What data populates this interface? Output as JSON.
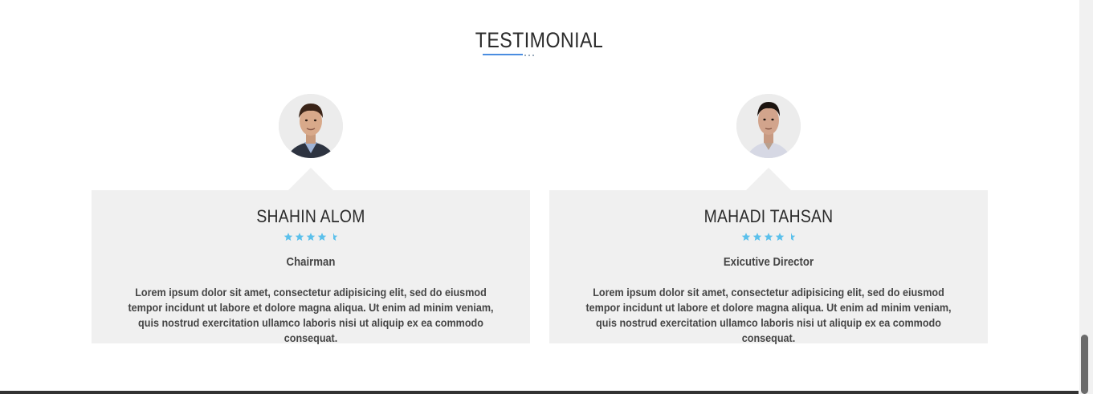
{
  "section": {
    "title": "TESTIMONIAL"
  },
  "testimonials": [
    {
      "name": "SHAHIN ALOM",
      "rating": 4.5,
      "role": "Chairman",
      "quote": "Lorem ipsum dolor sit amet, consectetur adipisicing elit, sed do eiusmod tempor incidunt ut labore et dolore magna aliqua. Ut enim ad minim veniam, quis nostrud exercitation ullamco laboris nisi ut aliquip ex ea commodo consequat."
    },
    {
      "name": "MAHADI TAHSAN",
      "rating": 4.5,
      "role": "Exicutive Director",
      "quote": "Lorem ipsum dolor sit amet, consectetur adipisicing elit, sed do eiusmod tempor incidunt ut labore et dolore magna aliqua. Ut enim ad minim veniam, quis nostrud exercitation ullamco laboris nisi ut aliquip ex ea commodo consequat."
    }
  ],
  "colors": {
    "star": "#5bc0eb",
    "card_bg": "#f0f0f0",
    "title_underline": "#4a8de0",
    "text": "#2b2b2b"
  },
  "icons": {
    "star": "star-icon",
    "half_star": "half-star-icon"
  }
}
